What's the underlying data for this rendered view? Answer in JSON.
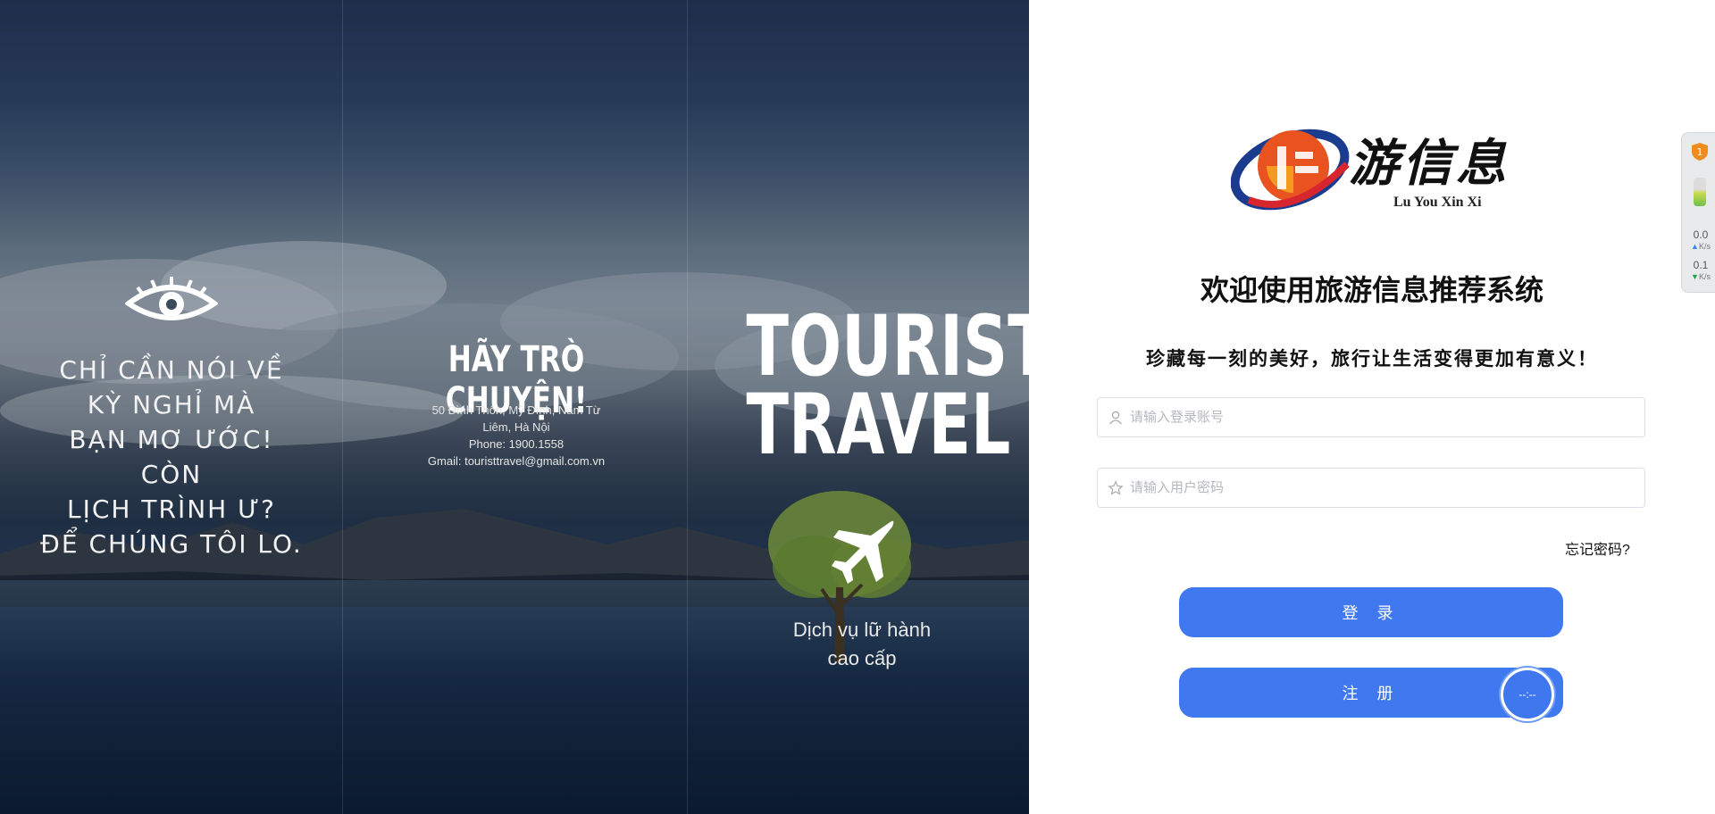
{
  "hero": {
    "left_text": "CHỈ CẦN NÓI VỀ\nKỲ NGHỈ MÀ\nBẠN MƠ ƯỚC! CÒN\nLỊCH TRÌNH Ư?\nĐỂ CHÚNG TÔI LO.",
    "mid_title": "HÃY TRÒ CHUYỆN!",
    "mid_info": "50 Đình Thôn, Mỹ Đình, Nam Từ\nLiêm, Hà Nội\nPhone: 1900.1558\nGmail: touristtravel@gmail.com.vn",
    "brand_title": "TOURIST\nTRAVEL",
    "brand_sub": "Dịch vụ lữ hành\ncao cấp",
    "icons": [
      "eye-icon",
      "plane-icon"
    ]
  },
  "login": {
    "logo_cn": "游信息",
    "logo_en": "Lu You Xin Xi",
    "welcome": "欢迎使用旅游信息推荐系统",
    "slogan": "珍藏每一刻的美好，旅行让生活变得更加有意义！",
    "username_placeholder": "请输入登录账号",
    "password_placeholder": "请输入用户密码",
    "forgot_label": "忘记密码?",
    "login_label": "登 录",
    "register_label": "注 册",
    "accent": "#4079ef",
    "icons": [
      "user-icon",
      "star-icon"
    ]
  },
  "float_widget": {
    "label": "--:--"
  },
  "side_widget": {
    "badge": "1",
    "upload_speed": "0.0",
    "download_speed": "0.1",
    "unit": "K/s"
  }
}
